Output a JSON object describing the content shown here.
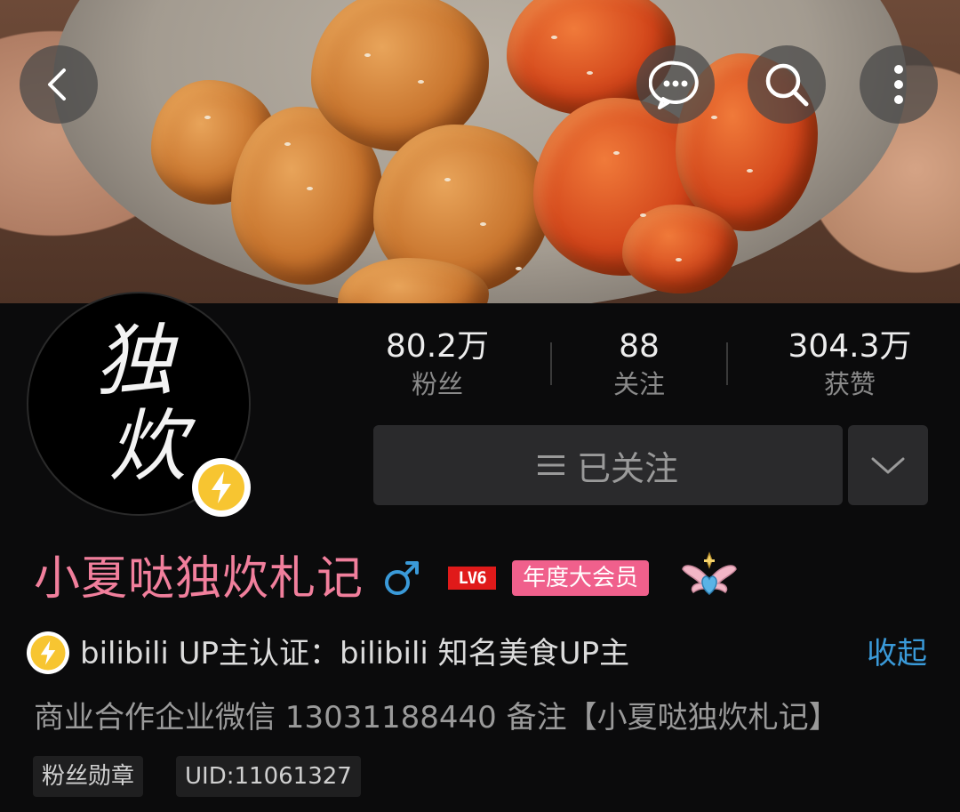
{
  "header": {
    "back_icon": "chevron-left-icon",
    "message_icon": "chat-bubble-icon",
    "search_icon": "search-icon",
    "more_icon": "more-vertical-icon"
  },
  "avatar": {
    "line1": "独",
    "line2": "炊",
    "badge_icon": "lightning-icon",
    "badge_color": "#f7c531"
  },
  "stats": [
    {
      "value": "80.2万",
      "label": "粉丝"
    },
    {
      "value": "88",
      "label": "关注"
    },
    {
      "value": "304.3万",
      "label": "获赞"
    }
  ],
  "follow": {
    "label": "已关注",
    "menu_icon": "menu-lines-icon",
    "dropdown_icon": "chevron-down-icon"
  },
  "profile": {
    "name": "小夏哒独炊札记",
    "name_color": "#f17f9c",
    "gender_icon": "male-icon",
    "level": "LV6",
    "vip_label": "年度大会员",
    "pendant_icon": "winged-heart-pendant-icon"
  },
  "verification": {
    "text": "bilibili UP主认证：bilibili 知名美食UP主",
    "collapse_label": "收起",
    "accent_color": "#3a9ad9"
  },
  "description": "商业合作企业微信 13031188440 备注【小夏哒独炊札记】",
  "tags": {
    "fan_medal": "粉丝勋章",
    "uid": "UID:11061327"
  }
}
